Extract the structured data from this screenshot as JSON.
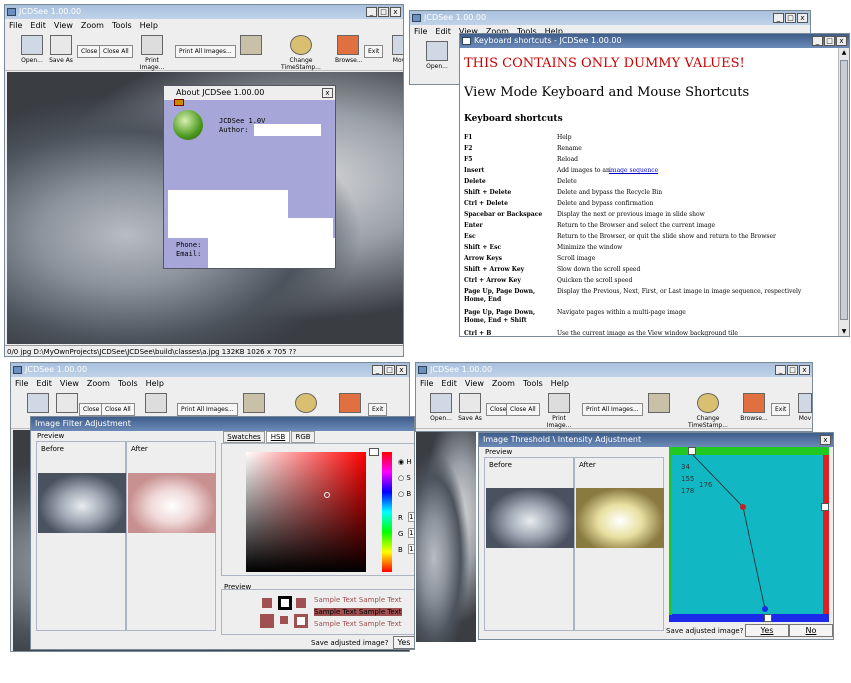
{
  "app_title": "JCDSee 1.00.00",
  "menu": [
    "File",
    "Edit",
    "View",
    "Zoom",
    "Tools",
    "Help"
  ],
  "toolbar": {
    "open": "Open...",
    "save_as": "Save As",
    "close": "Close",
    "close_all": "Close All",
    "print_image": "Print Image...",
    "print_all": "Print All Images...",
    "properties": "Properties",
    "change_timestamp": "Change TimeStamp...",
    "browse": "Browse...",
    "exit": "Exit",
    "move": "Mov"
  },
  "main_window": {
    "status": "0/0  jpg  D:\\MyOwnProjects\\JCDSee\\JCDSee\\build\\classes\\a.jpg  132KB  1026 x 705 ??"
  },
  "about_dialog": {
    "title": "About JCDSee 1.00.00",
    "version": "JCDSee 1.0V",
    "author_label": "Author:",
    "phone_label": "Phone:",
    "email_label": "Email:"
  },
  "shortcuts_window": {
    "title": "Keyboard shortcuts - JCDSee 1.00.00",
    "warning": "THIS CONTAINS ONLY DUMMY VALUES!",
    "heading": "View Mode Keyboard and Mouse Shortcuts",
    "subheading": "Keyboard shortcuts",
    "link_text": "image sequence",
    "rows": [
      {
        "key": "F1",
        "desc": "Help"
      },
      {
        "key": "F2",
        "desc": "Rename"
      },
      {
        "key": "F5",
        "desc": "Reload"
      },
      {
        "key": "Insert",
        "desc": "Add images to an "
      },
      {
        "key": "Delete",
        "desc": "Delete"
      },
      {
        "key": "Shift + Delete",
        "desc": "Delete and bypass the Recycle Bin"
      },
      {
        "key": "Ctrl + Delete",
        "desc": "Delete and bypass confirmation"
      },
      {
        "key": "Spacebar or Backspace",
        "desc": "Display the next or previous image in slide show"
      },
      {
        "key": "Enter",
        "desc": "Return to the Browser and select the current image"
      },
      {
        "key": "Esc",
        "desc": "Return to the Browser, or quit the slide show and return to the Browser"
      },
      {
        "key": "Shift + Esc",
        "desc": "Minimize the window"
      },
      {
        "key": "Arrow Keys",
        "desc": "Scroll image"
      },
      {
        "key": "Shift + Arrow Key",
        "desc": "Slow down the scroll speed"
      },
      {
        "key": "Ctrl + Arrow Key",
        "desc": "Quicken the scroll speed"
      },
      {
        "key": "Page Up, Page Down, Home, End",
        "desc": "Display the Previous, Next, First, or Last image in image sequence, respectively"
      },
      {
        "key": "Page Up, Page Down, Home, End + Shift",
        "desc": "Navigate pages within a multi-page image"
      },
      {
        "key": "Ctrl + B",
        "desc": "Use the current image as the View window background tile"
      }
    ]
  },
  "filter_dialog": {
    "title": "Image Filter Adjustment",
    "preview": "Preview",
    "before": "Before",
    "after": "After",
    "tabs": [
      "Swatches",
      "HSB",
      "RGB"
    ],
    "radio": [
      "H",
      "S",
      "B"
    ],
    "rgb_labels": [
      "R",
      "G",
      "B"
    ],
    "rgb_values": [
      "1",
      "1",
      "1"
    ],
    "preview2": "Preview",
    "sample_text": "Sample Text",
    "save_prompt": "Save adjusted image?",
    "yes": "Yes"
  },
  "threshold_dialog": {
    "title": "Image Threshold \\ Intensity Adjustment",
    "preview": "Preview",
    "before": "Before",
    "after": "After",
    "values": [
      "34",
      "155",
      "178",
      "176"
    ],
    "save_prompt": "Save adjusted image?",
    "yes": "Yes",
    "no": "No"
  },
  "colors": {
    "title_active": "#3e5d8a",
    "title_inactive": "#b9cde5",
    "warning_red": "#cc0000",
    "threshold_bg": "#11b8c4",
    "link_blue": "#0000cc"
  }
}
